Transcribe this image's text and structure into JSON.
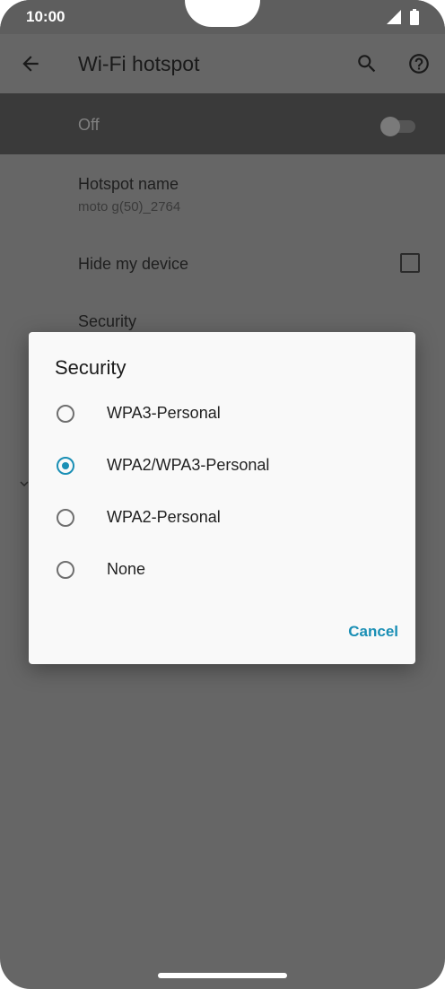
{
  "status_bar": {
    "time": "10:00"
  },
  "app_bar": {
    "title": "Wi-Fi hotspot"
  },
  "master_switch": {
    "label": "Off",
    "enabled": false
  },
  "settings": {
    "hotspot_name": {
      "title": "Hotspot name",
      "value": "moto g(50)_2764"
    },
    "hide_device": {
      "title": "Hide my device",
      "checked": false
    },
    "security": {
      "title": "Security"
    }
  },
  "dialog": {
    "title": "Security",
    "options": [
      {
        "label": "WPA3-Personal",
        "selected": false
      },
      {
        "label": "WPA2/WPA3-Personal",
        "selected": true
      },
      {
        "label": "WPA2-Personal",
        "selected": false
      },
      {
        "label": "None",
        "selected": false
      }
    ],
    "cancel_label": "Cancel"
  },
  "colors": {
    "accent": "#1a8fb5",
    "scrim": "#666666",
    "dialog_bg": "#f9f9f9"
  },
  "icons": [
    "back-arrow-icon",
    "search-icon",
    "help-icon",
    "signal-icon",
    "battery-icon",
    "chevron-icon"
  ]
}
